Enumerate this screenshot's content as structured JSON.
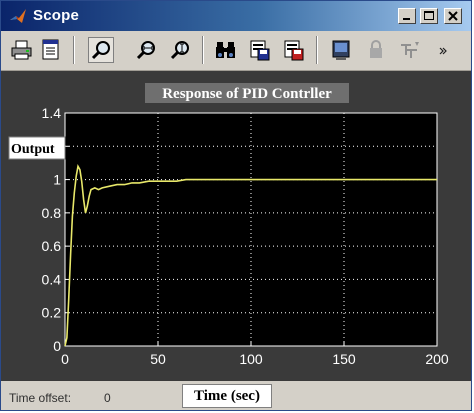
{
  "window": {
    "title": "Scope",
    "title_icon": "matlab-logo-icon",
    "controls": {
      "minimize": "minimize-icon",
      "maximize": "maximize-icon",
      "close": "close-icon"
    }
  },
  "toolbar": {
    "buttons": [
      {
        "name": "print-button",
        "icon": "printer-icon"
      },
      {
        "name": "parameters-button",
        "icon": "parameters-icon"
      },
      {
        "name": "zoom-button",
        "icon": "zoom-icon"
      },
      {
        "name": "zoom-x-button",
        "icon": "zoom-x-axis-icon"
      },
      {
        "name": "zoom-y-button",
        "icon": "zoom-y-axis-icon"
      },
      {
        "name": "autoscale-button",
        "icon": "binoculars-icon"
      },
      {
        "name": "save-axes-button",
        "icon": "save-axes-settings-icon"
      },
      {
        "name": "restore-axes-button",
        "icon": "restore-axes-settings-icon"
      },
      {
        "name": "floating-scope-button",
        "icon": "floating-scope-icon"
      },
      {
        "name": "lock-axes-button",
        "icon": "lock-icon"
      },
      {
        "name": "signal-selection-button",
        "icon": "signal-selection-icon"
      }
    ]
  },
  "footer": {
    "time_offset_label": "Time offset:",
    "time_offset_value": "0"
  },
  "colors": {
    "axes_background": "#000000",
    "signal": "#e8e86a",
    "grid": "#ffffff",
    "window_face": "#d4d0c8"
  },
  "chart_data": {
    "type": "line",
    "title": "Response of PID Contrller",
    "ylabel": "Output",
    "xlabel": "Time (sec)",
    "xlim": [
      0,
      200
    ],
    "ylim": [
      0,
      1.4
    ],
    "xticks": [
      0,
      50,
      100,
      150,
      200
    ],
    "yticks": [
      0,
      0.2,
      0.4,
      0.6,
      0.8,
      1,
      1.2,
      1.4
    ],
    "grid": true,
    "series": [
      {
        "x": [
          0,
          1,
          2,
          3,
          4,
          5,
          6,
          7,
          8,
          9,
          10,
          11,
          12,
          13,
          14,
          16,
          18,
          20,
          24,
          28,
          32,
          36,
          40,
          45,
          50,
          55,
          60,
          65,
          70,
          75,
          80,
          85,
          90,
          95,
          100,
          110,
          120,
          140,
          160,
          180,
          200
        ],
        "y": [
          0,
          0.05,
          0.28,
          0.55,
          0.78,
          0.92,
          1.02,
          1.08,
          1.06,
          0.99,
          0.88,
          0.8,
          0.84,
          0.9,
          0.94,
          0.95,
          0.94,
          0.95,
          0.96,
          0.97,
          0.97,
          0.98,
          0.98,
          0.99,
          0.99,
          0.99,
          0.99,
          1.0,
          1.0,
          1.0,
          1.0,
          1.0,
          1.0,
          1.0,
          1.0,
          1.0,
          1.0,
          1.0,
          1.0,
          1.0,
          1.0
        ]
      }
    ]
  }
}
